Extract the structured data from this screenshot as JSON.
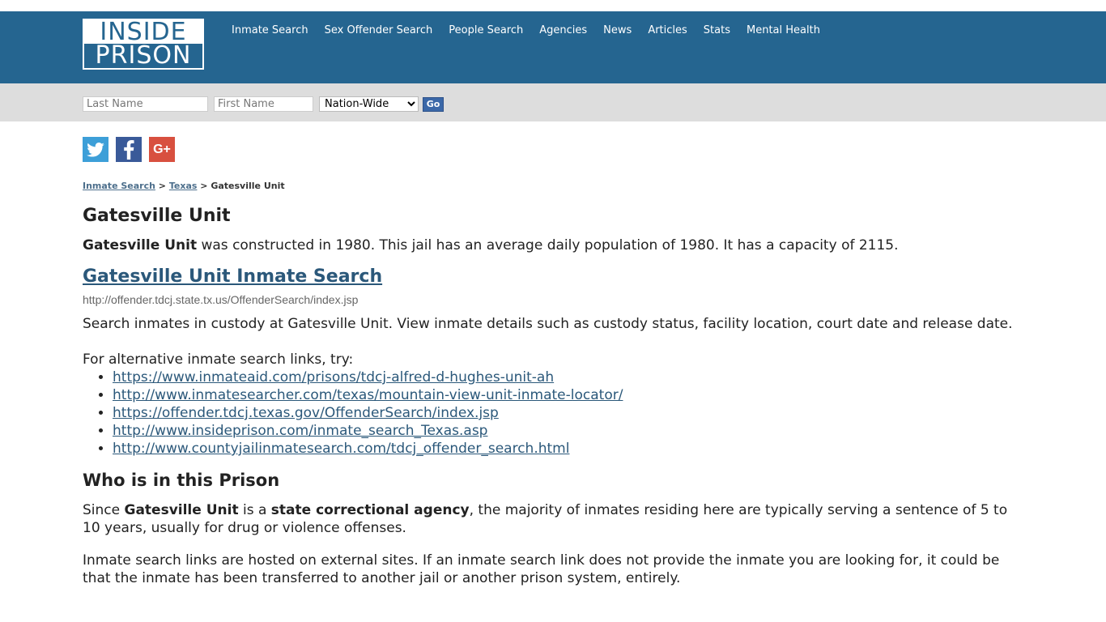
{
  "logo": {
    "top": "INSIDE",
    "bottom": "PRISON"
  },
  "nav": [
    {
      "label": "Inmate Search"
    },
    {
      "label": "Sex Offender Search"
    },
    {
      "label": "People Search"
    },
    {
      "label": "Agencies"
    },
    {
      "label": "News"
    },
    {
      "label": "Articles"
    },
    {
      "label": "Stats"
    },
    {
      "label": "Mental Health"
    }
  ],
  "search": {
    "last_placeholder": "Last Name",
    "first_placeholder": "First Name",
    "scope_selected": "Nation-Wide",
    "go_label": "Go"
  },
  "social": {
    "gplus": "G+"
  },
  "breadcrumb": {
    "root": "Inmate Search",
    "state": "Texas",
    "current": "Gatesville Unit",
    "sep": ">"
  },
  "page": {
    "title": "Gatesville Unit",
    "intro_strong": "Gatesville Unit",
    "intro_rest": " was constructed in 1980. This jail has an average daily population of 1980. It has a capacity of 2115.",
    "search_link": "Gatesville Unit Inmate Search",
    "search_url": "http://offender.tdcj.state.tx.us/OffenderSearch/index.jsp",
    "description": "Search inmates in custody at Gatesville Unit. View inmate details such as custody status, facility location, court date and release date.",
    "alt_intro": "For alternative inmate search links, try:",
    "alt_links": [
      "https://www.inmateaid.com/prisons/tdcj-alfred-d-hughes-unit-ah",
      "http://www.inmatesearcher.com/texas/mountain-view-unit-inmate-locator/",
      "https://offender.tdcj.texas.gov/OffenderSearch/index.jsp",
      "http://www.insideprison.com/inmate_search_Texas.asp",
      "http://www.countyjailinmatesearch.com/tdcj_offender_search.html"
    ],
    "who_heading": "Who is in this Prison",
    "who_since": "Since ",
    "who_name": "Gatesville Unit",
    "who_isa": " is a ",
    "who_agency": "state correctional agency",
    "who_rest": ", the majority of inmates residing here are typically serving a sentence of 5 to 10 years, usually for drug or violence offenses.",
    "note": "Inmate search links are hosted on external sites. If an inmate search link does not provide the inmate you are looking for, it could be that the inmate has been transferred to another jail or another prison system, entirely."
  },
  "colors": {
    "header": "#256590",
    "search_bar": "#dddddd",
    "link": "#2b587a"
  }
}
